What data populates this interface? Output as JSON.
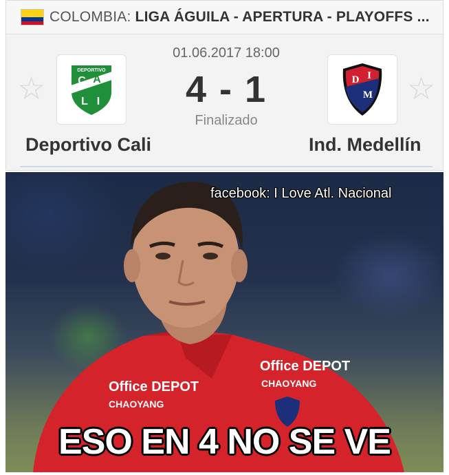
{
  "league": {
    "country": "COLOMBIA:",
    "competition": "LIGA ÁGUILA - APERTURA - PLAYOFFS ..."
  },
  "match": {
    "datetime": "01.06.2017 18:00",
    "score": "4 - 1",
    "status": "Finalizado",
    "home_team": "Deportivo Cali",
    "away_team": "Ind. Medellín"
  },
  "home_crest": {
    "top_text": "DEPORTIVO",
    "letters": [
      "C",
      "A",
      "L",
      "I"
    ],
    "primary": "#1f8f3a"
  },
  "away_crest": {
    "letters": [
      "D",
      "I",
      "M"
    ],
    "primary_red": "#d1202f",
    "primary_blue": "#1d2f7a"
  },
  "meme": {
    "watermark": "facebook: I Love Atl. Nacional",
    "caption": "ESO EN 4 NO SE VE",
    "shirt_text_1": "Office DEPOT",
    "shirt_text_2": "CHAOYANG"
  },
  "icons": {
    "favorite": "star-icon",
    "flag": "colombia-flag-icon"
  },
  "colors": {
    "card_bg": "#f3f3f3",
    "score_text": "#333333",
    "star": "#d7d7d7"
  }
}
